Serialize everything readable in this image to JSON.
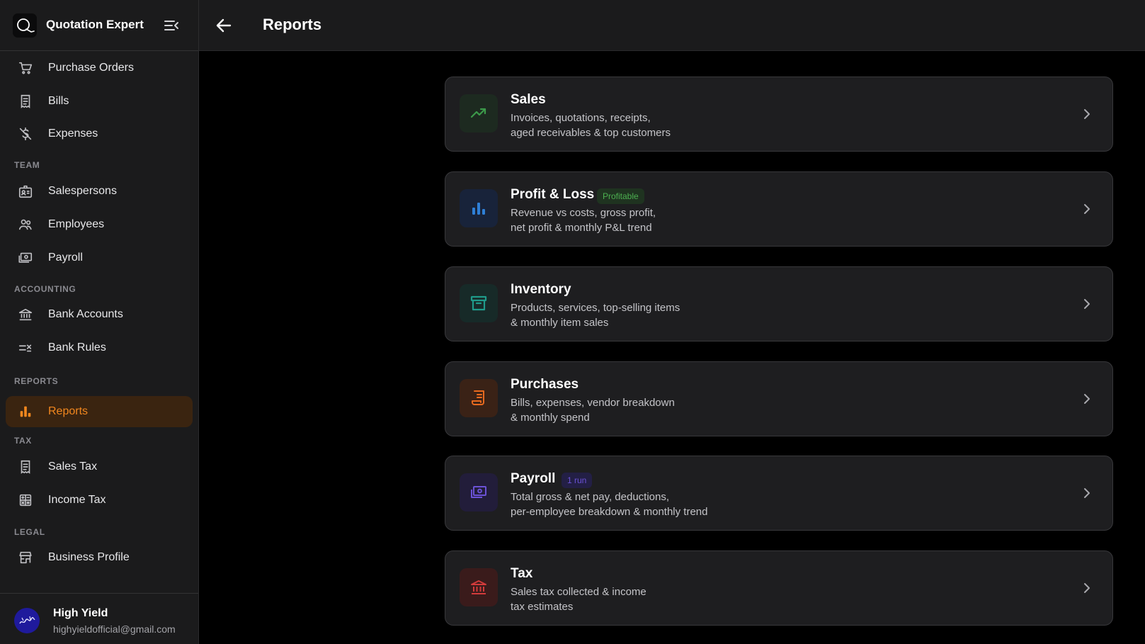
{
  "app": {
    "name": "Quotation Expert"
  },
  "header": {
    "title": "Reports"
  },
  "sidebar": {
    "top_items": [
      {
        "label": "Purchase Orders",
        "icon": "cart-icon"
      },
      {
        "label": "Bills",
        "icon": "receipt-icon"
      },
      {
        "label": "Expenses",
        "icon": "money-off-icon"
      }
    ],
    "sections": [
      {
        "label": "TEAM",
        "items": [
          {
            "label": "Salespersons",
            "icon": "badge-icon"
          },
          {
            "label": "Employees",
            "icon": "people-icon"
          },
          {
            "label": "Payroll",
            "icon": "payments-icon"
          }
        ]
      },
      {
        "label": "ACCOUNTING",
        "items": [
          {
            "label": "Bank Accounts",
            "icon": "bank-icon"
          },
          {
            "label": "Bank Rules",
            "icon": "rule-icon"
          }
        ]
      },
      {
        "label": "REPORTS",
        "items": [
          {
            "label": "Reports",
            "icon": "bar-chart-icon",
            "active": true
          }
        ]
      },
      {
        "label": "TAX",
        "items": [
          {
            "label": "Sales Tax",
            "icon": "receipt-icon"
          },
          {
            "label": "Income Tax",
            "icon": "calculator-icon"
          }
        ]
      },
      {
        "label": "LEGAL",
        "items": [
          {
            "label": "Business Profile",
            "icon": "store-icon"
          }
        ]
      }
    ],
    "active_color": "#f2871e"
  },
  "user": {
    "name": "High Yield",
    "email": "highyieldofficial@gmail.com"
  },
  "cards": [
    {
      "title": "Sales",
      "lines": [
        "Invoices, quotations, receipts,",
        "aged receivables & top customers"
      ],
      "icon": "trending-up-icon",
      "color": "#3c9a4a"
    },
    {
      "title": "Profit & Loss",
      "badge": "Profitable",
      "lines": [
        "Revenue vs costs, gross profit,",
        "net profit & monthly P&L trend"
      ],
      "icon": "bar-chart-icon",
      "color": "#2f7fd6"
    },
    {
      "title": "Inventory",
      "lines": [
        "Products, services, top-selling items",
        "& monthly item sales"
      ],
      "icon": "archive-icon",
      "color": "#1f9a8a"
    },
    {
      "title": "Purchases",
      "lines": [
        "Bills, expenses, vendor breakdown",
        "& monthly spend"
      ],
      "icon": "receipt-icon",
      "color": "#e86a1f"
    },
    {
      "title": "Payroll",
      "badge": "1 run",
      "lines": [
        "Total gross & net pay, deductions,",
        "per-employee breakdown & monthly trend"
      ],
      "icon": "payments-icon",
      "color": "#6b52d6"
    },
    {
      "title": "Tax",
      "lines": [
        "Sales tax collected & income",
        "tax estimates"
      ],
      "icon": "bank-icon",
      "color": "#d23b3b"
    }
  ]
}
